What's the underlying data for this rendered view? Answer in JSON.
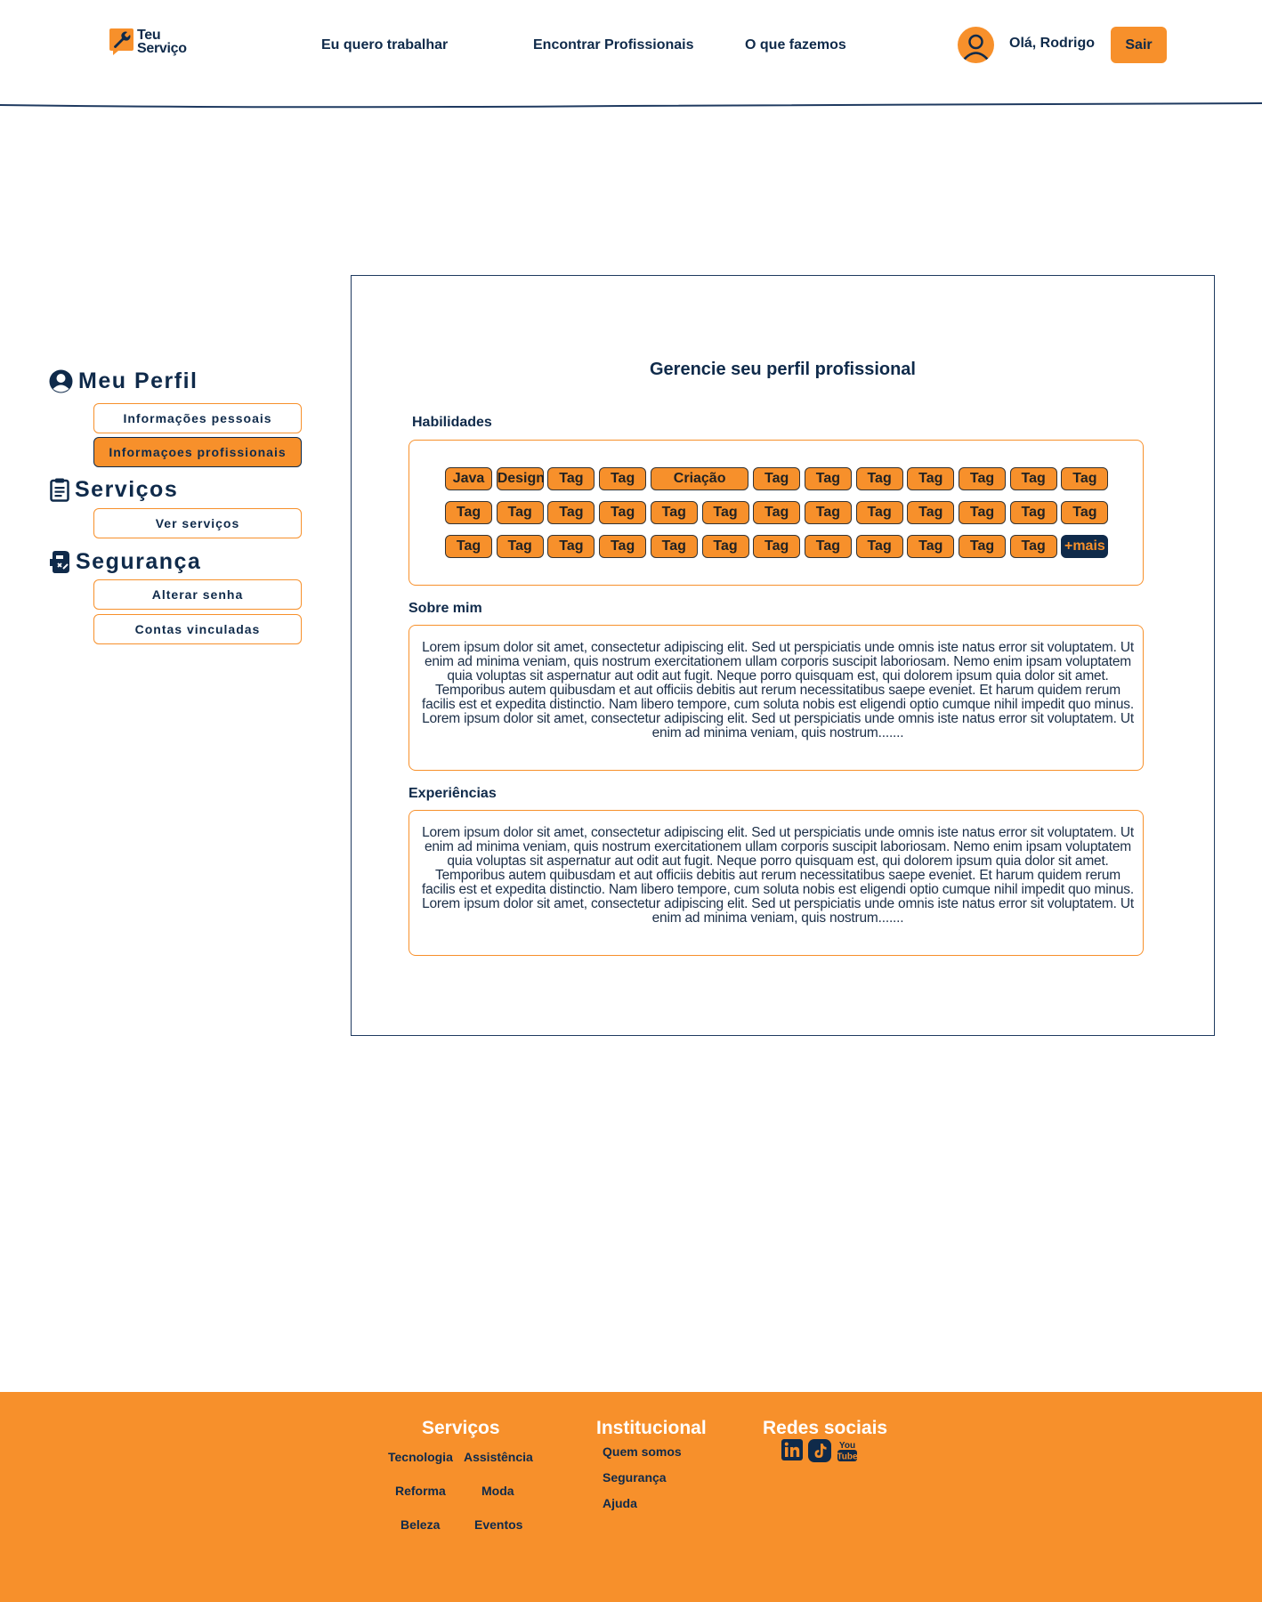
{
  "brand": {
    "name_line1": "Teu",
    "name_line2": "Serviço"
  },
  "nav": {
    "links": [
      "Eu quero trabalhar",
      "Encontrar Profissionais",
      "O que fazemos"
    ],
    "greeting": "Olá, Rodrigo",
    "logout_label": "Sair"
  },
  "sidebar": {
    "sections": [
      {
        "title": "Meu Perfil",
        "icon": "user-circle-icon",
        "items": [
          "Informações pessoais",
          "Informaçoes profissionais"
        ]
      },
      {
        "title": "Serviços",
        "icon": "clipboard-icon",
        "items": [
          "Ver serviços"
        ]
      },
      {
        "title": "Segurança",
        "icon": "security-icon",
        "items": [
          "Alterar senha",
          "Contas vinculadas"
        ]
      }
    ],
    "active_item": "Informaçoes profissionais"
  },
  "main": {
    "title": "Gerencie seu perfil profissional",
    "skills_label": "Habilidades",
    "tag_rows": [
      [
        "Java",
        "Design",
        "Tag",
        "Tag",
        "Criação",
        "Tag",
        "Tag",
        "Tag",
        "Tag",
        "Tag",
        "Tag",
        "Tag"
      ],
      [
        "Tag",
        "Tag",
        "Tag",
        "Tag",
        "Tag",
        "Tag",
        "Tag",
        "Tag",
        "Tag",
        "Tag",
        "Tag",
        "Tag",
        "Tag"
      ],
      [
        "Tag",
        "Tag",
        "Tag",
        "Tag",
        "Tag",
        "Tag",
        "Tag",
        "Tag",
        "Tag",
        "Tag",
        "Tag",
        "Tag",
        "+mais"
      ]
    ],
    "about_label": "Sobre mim",
    "about_text": "Lorem ipsum dolor sit amet, consectetur adipiscing elit. Sed ut perspiciatis unde omnis iste natus error sit voluptatem. Ut enim ad minima veniam, quis nostrum exercitationem ullam corporis suscipit laboriosam. Nemo enim ipsam voluptatem quia voluptas sit aspernatur aut odit aut fugit. Neque porro quisquam est, qui dolorem ipsum quia dolor sit amet. Temporibus autem quibusdam et aut officiis debitis aut rerum necessitatibus saepe eveniet. Et harum quidem rerum facilis est et expedita distinctio. Nam libero tempore, cum soluta nobis est eligendi optio cumque nihil impedit quo minus. Lorem ipsum dolor sit amet, consectetur adipiscing elit. Sed ut perspiciatis unde omnis iste natus error sit voluptatem. Ut enim ad minima veniam, quis nostrum.......",
    "experience_label": "Experiências",
    "experience_text": "Lorem ipsum dolor sit amet, consectetur adipiscing elit. Sed ut perspiciatis unde omnis iste natus error sit voluptatem. Ut enim ad minima veniam, quis nostrum exercitationem ullam corporis suscipit laboriosam. Nemo enim ipsam voluptatem quia voluptas sit aspernatur aut odit aut fugit. Neque porro quisquam est, qui dolorem ipsum quia dolor sit amet. Temporibus autem quibusdam et aut officiis debitis aut rerum necessitatibus saepe eveniet. Et harum quidem rerum facilis est et expedita distinctio. Nam libero tempore, cum soluta nobis est eligendi optio cumque nihil impedit quo minus. Lorem ipsum dolor sit amet, consectetur adipiscing elit. Sed ut perspiciatis unde omnis iste natus error sit voluptatem. Ut enim ad minima veniam, quis nostrum......."
  },
  "footer": {
    "services_title": "Serviços",
    "services": [
      "Tecnologia",
      "Assistência",
      "Reforma",
      "Moda",
      "Beleza",
      "Eventos"
    ],
    "institutional_title": "Institucional",
    "institutional": [
      "Quem somos",
      "Segurança",
      "Ajuda"
    ],
    "social_title": "Redes sociais",
    "social_icons": [
      "linkedin-icon",
      "tiktok-icon",
      "youtube-icon"
    ],
    "youtube_text_1": "You",
    "youtube_text_2": "Tube"
  },
  "colors": {
    "accent": "#f7902b",
    "navy": "#0f2a4a"
  }
}
